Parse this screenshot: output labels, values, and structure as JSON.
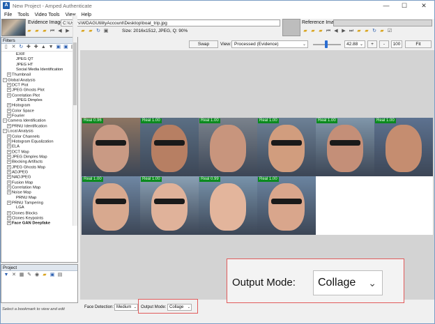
{
  "window": {
    "title": "New Project - Amped Authenticate",
    "minimize": "—",
    "maximize": "☐",
    "close": "✕"
  },
  "menu": [
    "File",
    "Tools",
    "Video Tools",
    "View",
    "Help"
  ],
  "evidence": {
    "label": "Evidence Image:",
    "path": "C:\\Users\\WDAGUtilityAccount\\Desktop\\boat_trip.jpg",
    "size_info": "Size: 2016x1512, JPEG, Q: 90%"
  },
  "reference": {
    "label": "Reference Image:"
  },
  "filters": {
    "header": "Filters",
    "tree": [
      {
        "label": "EXIF",
        "indent": 2,
        "expander": false
      },
      {
        "label": "JPEG QT",
        "indent": 2,
        "expander": false
      },
      {
        "label": "JPEG HT",
        "indent": 2,
        "expander": false
      },
      {
        "label": "Social Media Identification",
        "indent": 2,
        "expander": false
      },
      {
        "label": "Thumbnail",
        "indent": 1,
        "expander": true
      },
      {
        "label": "Global Analysis",
        "indent": 0,
        "expander": true
      },
      {
        "label": "DCT Plot",
        "indent": 1,
        "expander": true
      },
      {
        "label": "JPEG Ghosts Plot",
        "indent": 1,
        "expander": true
      },
      {
        "label": "Correlation Plot",
        "indent": 1,
        "expander": true
      },
      {
        "label": "JPEG Dimples",
        "indent": 2,
        "expander": false
      },
      {
        "label": "Histogram",
        "indent": 1,
        "expander": true
      },
      {
        "label": "Color Space",
        "indent": 1,
        "expander": true
      },
      {
        "label": "Fourier",
        "indent": 1,
        "expander": true
      },
      {
        "label": "Camera Identification",
        "indent": 0,
        "expander": true
      },
      {
        "label": "PRNU Identification",
        "indent": 1,
        "expander": true
      },
      {
        "label": "Local Analysis",
        "indent": 0,
        "expander": true
      },
      {
        "label": "Color Channels",
        "indent": 1,
        "expander": true
      },
      {
        "label": "Histogram Equalization",
        "indent": 1,
        "expander": true
      },
      {
        "label": "ELA",
        "indent": 1,
        "expander": true
      },
      {
        "label": "DCT Map",
        "indent": 1,
        "expander": true
      },
      {
        "label": "JPEG Dimples Map",
        "indent": 1,
        "expander": true
      },
      {
        "label": "Blocking Artifacts",
        "indent": 1,
        "expander": true
      },
      {
        "label": "JPEG Ghosts Map",
        "indent": 1,
        "expander": true
      },
      {
        "label": "ADJPEG",
        "indent": 1,
        "expander": true
      },
      {
        "label": "NADJPEG",
        "indent": 1,
        "expander": true
      },
      {
        "label": "Fusion Map",
        "indent": 1,
        "expander": true
      },
      {
        "label": "Correlation Map",
        "indent": 1,
        "expander": true
      },
      {
        "label": "Noise Map",
        "indent": 1,
        "expander": true
      },
      {
        "label": "PRNU Map",
        "indent": 2,
        "expander": false
      },
      {
        "label": "PRNU Tampering",
        "indent": 1,
        "expander": true
      },
      {
        "label": "LGA",
        "indent": 2,
        "expander": false
      },
      {
        "label": "Clones Blocks",
        "indent": 1,
        "expander": true
      },
      {
        "label": "Clones Keypoints",
        "indent": 1,
        "expander": true
      },
      {
        "label": "Face GAN Deepfake",
        "indent": 1,
        "expander": true,
        "bold": true
      }
    ]
  },
  "project": {
    "header": "Project",
    "hint": "Select a bookmark to view and edit"
  },
  "viewer": {
    "swap": "Swap",
    "view_label": "View:",
    "view_value": "Processed (Evidence)",
    "zoom_value": "42.88",
    "zoom_level": 0.48,
    "plus": "+",
    "minus": "-",
    "pct": "100",
    "fit": "Fit"
  },
  "collage": {
    "tiles": [
      {
        "label": "Real 0.96",
        "bg": "#8d7562",
        "skin": "#c99a84"
      },
      {
        "label": "Real 1.00",
        "bg": "#5b6f84",
        "skin": "#b77f63"
      },
      {
        "label": "Real 1.00",
        "bg": "#7a828c",
        "skin": "#c8957d"
      },
      {
        "label": "Real 1.00",
        "bg": "#6d8196",
        "skin": "#d19d7e"
      },
      {
        "label": "Real 1.00",
        "bg": "#8096aa",
        "skin": "#c48f78"
      },
      {
        "label": "Real 1.00",
        "bg": "#5d7290",
        "skin": "#c58d70"
      },
      {
        "label": "Real 1.00",
        "bg": "#6f87a3",
        "skin": "#d8a98f"
      },
      {
        "label": "Real 1.00",
        "bg": "#8aa0b4",
        "skin": "#e0b29a"
      },
      {
        "label": "Real 0.99",
        "bg": "#7893ab",
        "skin": "#e3b59c"
      },
      {
        "label": "Real 1.00",
        "bg": "#6b84a0",
        "skin": "#d9a68c"
      }
    ]
  },
  "bottom": {
    "face_detection_label": "Face Detection:",
    "face_detection_value": "Medium",
    "output_mode_label": "Output Mode:",
    "output_mode_value": "Collage"
  },
  "callout": {
    "label": "Output Mode:",
    "value": "Collage"
  }
}
